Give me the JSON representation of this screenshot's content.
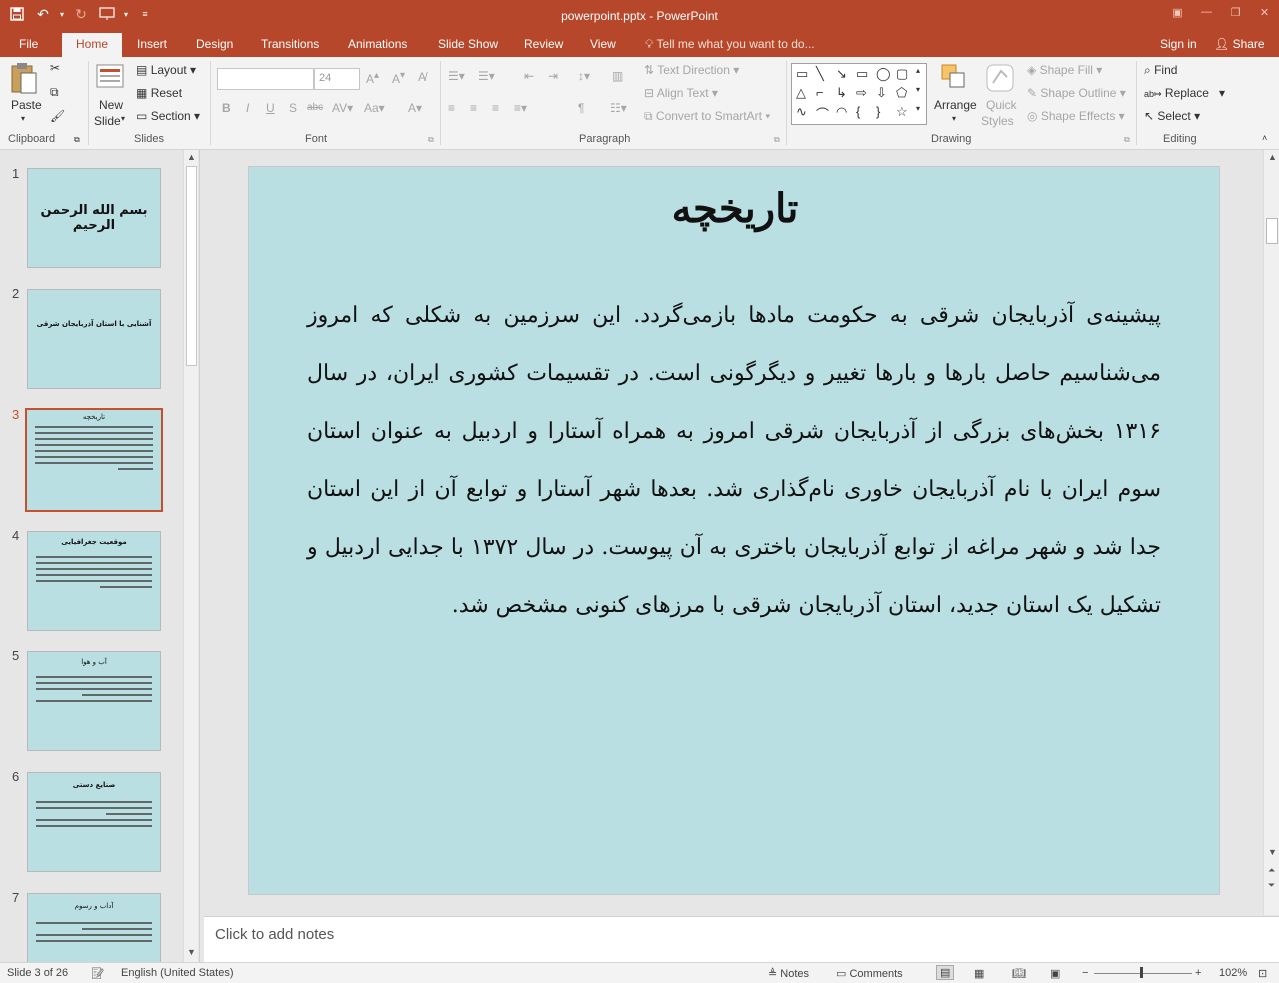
{
  "window": {
    "title": "powerpoint.pptx - PowerPoint",
    "accent_color": "#b7472a"
  },
  "qat": {
    "save_icon": "save-icon",
    "undo_icon": "undo-icon",
    "redo_icon": "redo-icon",
    "present_icon": "start-from-beginning-icon",
    "customize_icon": "customize-qat-icon"
  },
  "tabs": [
    {
      "label": "File"
    },
    {
      "label": "Home"
    },
    {
      "label": "Insert"
    },
    {
      "label": "Design"
    },
    {
      "label": "Transitions"
    },
    {
      "label": "Animations"
    },
    {
      "label": "Slide Show"
    },
    {
      "label": "Review"
    },
    {
      "label": "View"
    }
  ],
  "tell_me": "Tell me what you want to do...",
  "sign_in": "Sign in",
  "share": "Share",
  "ribbon": {
    "clipboard": {
      "paste": "Paste",
      "label": "Clipboard"
    },
    "slides": {
      "new_slide_1": "New",
      "new_slide_2": "Slide",
      "layout": "Layout",
      "reset": "Reset",
      "section": "Section",
      "label": "Slides"
    },
    "font": {
      "font_name": "",
      "font_size": "24",
      "label": "Font"
    },
    "paragraph": {
      "text_direction": "Text Direction",
      "align_text": "Align Text",
      "convert_smartart": "Convert to SmartArt",
      "label": "Paragraph"
    },
    "drawing": {
      "arrange": "Arrange",
      "quick_styles_1": "Quick",
      "quick_styles_2": "Styles",
      "shape_fill": "Shape Fill",
      "shape_outline": "Shape Outline",
      "shape_effects": "Shape Effects",
      "label": "Drawing"
    },
    "editing": {
      "find": "Find",
      "replace": "Replace",
      "select": "Select",
      "label": "Editing"
    }
  },
  "thumbnails": [
    {
      "num": "1",
      "title": "بسم الله الرحمن الرحیم",
      "kind": "calligraphy"
    },
    {
      "num": "2",
      "title": "آشنایی با استان آذربایجان شرقی",
      "kind": "title"
    },
    {
      "num": "3",
      "title": "تاریخچه",
      "kind": "text"
    },
    {
      "num": "4",
      "title": "موقعیت جغرافیایی",
      "kind": "text"
    },
    {
      "num": "5",
      "title": "آب و هوا",
      "kind": "text"
    },
    {
      "num": "6",
      "title": "صنایع دستی",
      "kind": "text"
    },
    {
      "num": "7",
      "title": "آداب و رسوم",
      "kind": "text"
    }
  ],
  "slide": {
    "title": "تاریخچه",
    "body": "پیشینه‌ی آذربایجان شرقی به حکومت مادها بازمی‌گردد. این سرزمین به شکلی که امروز می‌شناسیم حاصل بارها و بارها تغییر و دیگرگونی است. در تقسیمات کشوری ایران، در سال ۱۳۱۶ بخش‌های بزرگی از آذربایجان شرقی امروز به همراه آستارا و اردبیل به عنوان استان سوم ایران با نام آذربایجان خاوری نام‌گذاری شد. بعدها شهر آستارا و توابع آن از این استان جدا شد و شهر مراغه از توابع آذربایجان باختری به آن پیوست. در سال ۱۳۷۲ با جدایی اردبیل و تشکیل یک استان جدید، استان آذربایجان شرقی با مرزهای کنونی مشخص شد.",
    "background": "#badfe2"
  },
  "notes_placeholder": "Click to add notes",
  "status": {
    "slide_info": "Slide 3 of 26",
    "language": "English (United States)",
    "notes": "Notes",
    "comments": "Comments",
    "zoom": "102%"
  }
}
